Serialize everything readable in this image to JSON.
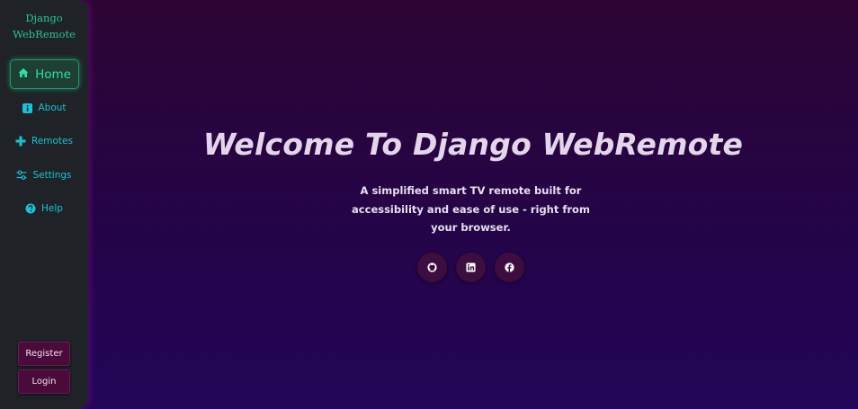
{
  "sidebar": {
    "brand_line1": "Django",
    "brand_line2": "WebRemote",
    "items": [
      {
        "label": "Home",
        "icon": "home-icon"
      },
      {
        "label": "About",
        "icon": "info-icon"
      },
      {
        "label": "Remotes",
        "icon": "gamepad-icon"
      },
      {
        "label": "Settings",
        "icon": "sliders-icon"
      },
      {
        "label": "Help",
        "icon": "question-icon"
      }
    ],
    "register_label": "Register",
    "login_label": "Login"
  },
  "hero": {
    "title": "Welcome To Django WebRemote",
    "subtitle": "A simplified smart TV remote built for accessibility and ease of use - right from your browser."
  },
  "social": [
    {
      "icon": "github-icon"
    },
    {
      "icon": "linkedin-icon"
    },
    {
      "icon": "facebook-icon"
    }
  ],
  "colors": {
    "accent_green": "#22c98f",
    "nav_cyan": "#17c3d6",
    "sidebar_bg": "#1f2327",
    "auth_button_bg": "#4a0a3a"
  }
}
